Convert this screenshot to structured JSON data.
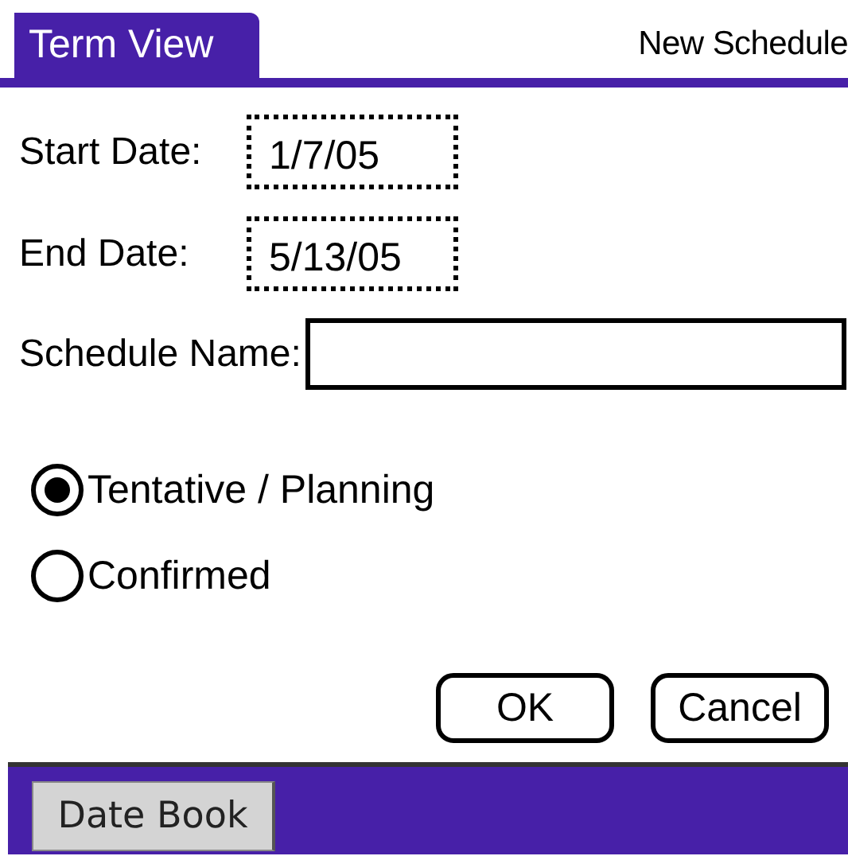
{
  "title_bar": {
    "title": "Term View",
    "subtitle": "New Schedule"
  },
  "fields": [
    {
      "kind": "date",
      "label": "Start Date:",
      "value": "1/7/05"
    },
    {
      "kind": "date",
      "label": "End Date:",
      "value": "5/13/05"
    },
    {
      "kind": "text",
      "label": "Schedule Name:"
    }
  ],
  "radios": [
    {
      "label": "Tentative / Planning",
      "selected": true
    },
    {
      "label": "Confirmed",
      "selected": false
    }
  ],
  "buttons": [
    "OK",
    "Cancel"
  ],
  "launcher": {
    "button": "Date Book"
  }
}
